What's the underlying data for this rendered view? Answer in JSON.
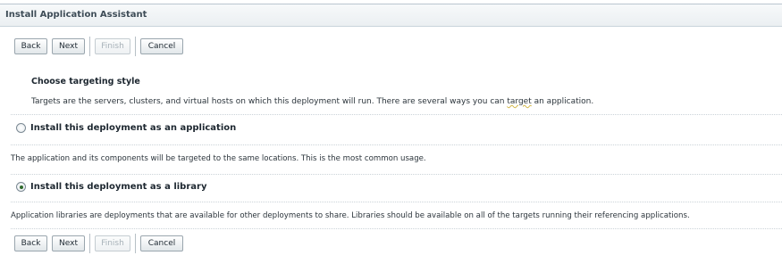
{
  "title": "Install Application Assistant",
  "buttons": {
    "back": "Back",
    "next": "Next",
    "finish": "Finish",
    "cancel": "Cancel"
  },
  "section": {
    "heading": "Choose targeting style",
    "description_before": "Targets are the servers, clusters, and virtual hosts on which this deployment will run. There are several ways you can ",
    "description_flagged_word": "target",
    "description_after": " an application."
  },
  "options": [
    {
      "label": "Install this deployment as an application",
      "selected": false,
      "note": "The application and its components will be targeted to the same locations. This is the most common usage."
    },
    {
      "label": "Install this deployment as a library",
      "selected": true,
      "note": "Application libraries are deployments that are available for other deployments to share. Libraries should be available on all of the targets running their referencing applications."
    }
  ],
  "colors": {
    "title_text": "#3e4c57",
    "radio_dot": "#2f6a2c",
    "disabled_text": "#a7b1b8"
  }
}
